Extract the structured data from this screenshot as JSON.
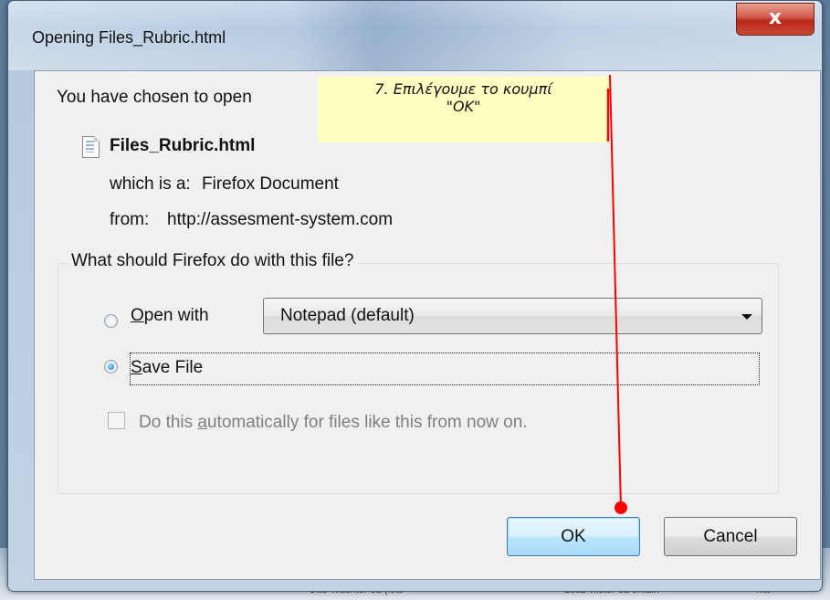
{
  "dialog": {
    "title": "Opening Files_Rubric.html",
    "close_glyph": "x",
    "chosen_text": "You have chosen to open",
    "file_icon": "html-file-icon",
    "filename": "Files_Rubric.html",
    "which_is_label": "which is a:",
    "which_is_value": "Firefox Document",
    "from_label": "from:",
    "from_value": "http://assesment-system.com",
    "group_label": "What should Firefox do with this file?",
    "open_with": {
      "label_underlined": "O",
      "label_rest": "pen with",
      "selected": false,
      "select_value": "Notepad (default)"
    },
    "save_file": {
      "label_underlined": "S",
      "label_rest": "ave File",
      "selected": true
    },
    "auto_checkbox": {
      "label_before": "Do this ",
      "label_underlined": "a",
      "label_after": "utomatically for files like this from now on.",
      "checked": false,
      "enabled": false
    },
    "ok_label": "OK",
    "cancel_label": "Cancel"
  },
  "annotation": {
    "line1": "7. Επιλέγουμε το κουμπί",
    "line2": "\"OK\"",
    "color": "#ff0000",
    "note_bg": "#ffffc2"
  },
  "background": {
    "text1": "Otto Wachter ea (lots",
    "text2": "Leaz vlistor ea entain",
    "text3": "Mtt"
  }
}
